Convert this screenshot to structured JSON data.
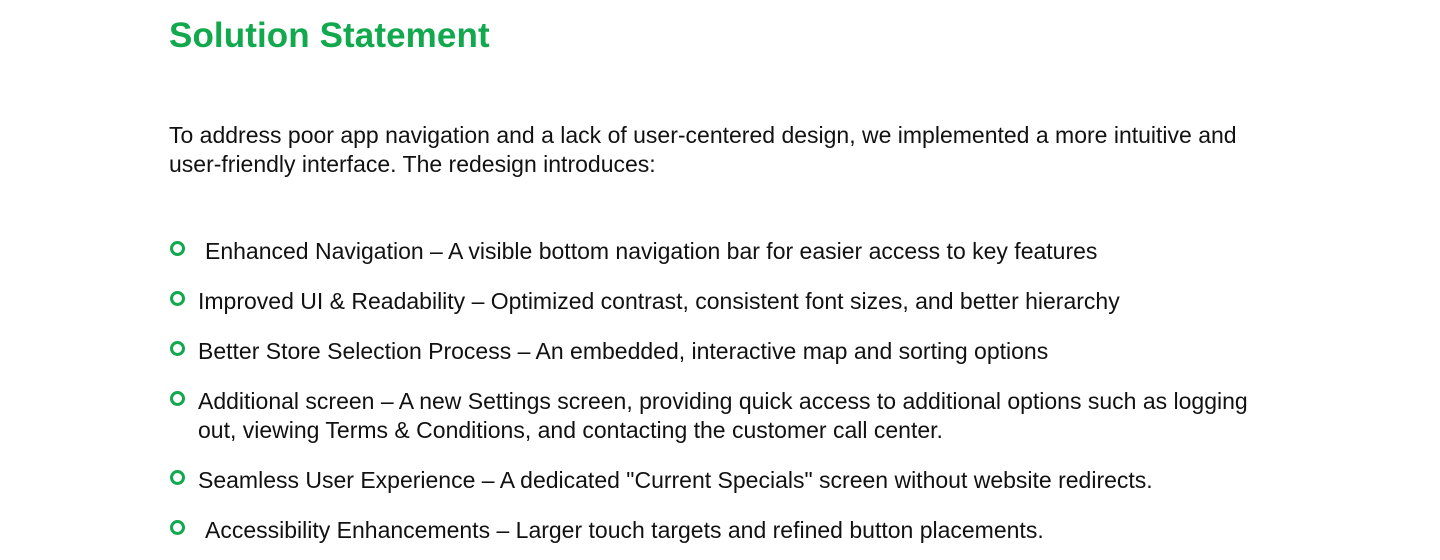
{
  "section": {
    "title": "Solution Statement",
    "intro": "To address poor app navigation and a lack of user-centered design, we implemented a more intuitive and user-friendly interface. The redesign introduces:"
  },
  "features": [
    {
      "icon": "circle-bullet-icon",
      "text": "Enhanced Navigation – A visible bottom navigation bar for easier access to key features"
    },
    {
      "icon": "circle-bullet-icon",
      "text": "Improved UI & Readability – Optimized contrast, consistent font sizes, and better hierarchy"
    },
    {
      "icon": "circle-bullet-icon",
      "text": "Better Store Selection Process – An embedded, interactive map and sorting options"
    },
    {
      "icon": "circle-bullet-icon",
      "text": "Additional screen – A new Settings screen, providing quick access to additional options such as logging out, viewing Terms & Conditions, and contacting the customer call center."
    },
    {
      "icon": "circle-bullet-icon",
      "text": "Seamless User Experience – A dedicated \"Current Specials\" screen without website redirects."
    },
    {
      "icon": "circle-bullet-icon",
      "text": "Accessibility Enhancements – Larger touch targets and refined button placements."
    }
  ],
  "colors": {
    "accent": "#11a84e",
    "text": "#111111",
    "background": "#ffffff"
  }
}
